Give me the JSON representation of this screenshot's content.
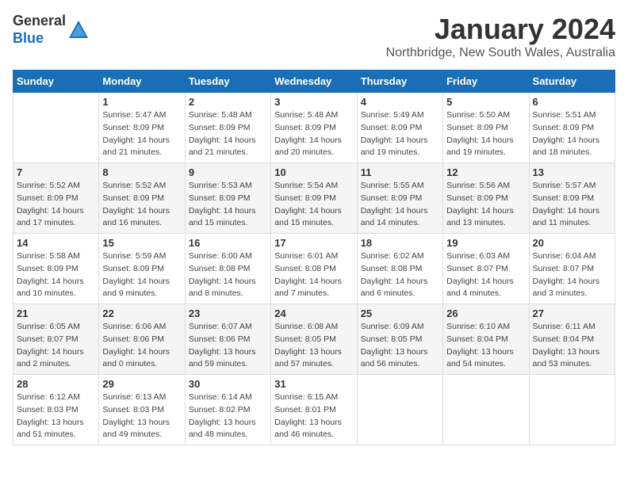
{
  "logo": {
    "general": "General",
    "blue": "Blue"
  },
  "header": {
    "title": "January 2024",
    "location": "Northbridge, New South Wales, Australia"
  },
  "columns": [
    "Sunday",
    "Monday",
    "Tuesday",
    "Wednesday",
    "Thursday",
    "Friday",
    "Saturday"
  ],
  "weeks": [
    [
      {
        "day": "",
        "info": ""
      },
      {
        "day": "1",
        "info": "Sunrise: 5:47 AM\nSunset: 8:09 PM\nDaylight: 14 hours\nand 21 minutes."
      },
      {
        "day": "2",
        "info": "Sunrise: 5:48 AM\nSunset: 8:09 PM\nDaylight: 14 hours\nand 21 minutes."
      },
      {
        "day": "3",
        "info": "Sunrise: 5:48 AM\nSunset: 8:09 PM\nDaylight: 14 hours\nand 20 minutes."
      },
      {
        "day": "4",
        "info": "Sunrise: 5:49 AM\nSunset: 8:09 PM\nDaylight: 14 hours\nand 19 minutes."
      },
      {
        "day": "5",
        "info": "Sunrise: 5:50 AM\nSunset: 8:09 PM\nDaylight: 14 hours\nand 19 minutes."
      },
      {
        "day": "6",
        "info": "Sunrise: 5:51 AM\nSunset: 8:09 PM\nDaylight: 14 hours\nand 18 minutes."
      }
    ],
    [
      {
        "day": "7",
        "info": "Sunrise: 5:52 AM\nSunset: 8:09 PM\nDaylight: 14 hours\nand 17 minutes."
      },
      {
        "day": "8",
        "info": "Sunrise: 5:52 AM\nSunset: 8:09 PM\nDaylight: 14 hours\nand 16 minutes."
      },
      {
        "day": "9",
        "info": "Sunrise: 5:53 AM\nSunset: 8:09 PM\nDaylight: 14 hours\nand 15 minutes."
      },
      {
        "day": "10",
        "info": "Sunrise: 5:54 AM\nSunset: 8:09 PM\nDaylight: 14 hours\nand 15 minutes."
      },
      {
        "day": "11",
        "info": "Sunrise: 5:55 AM\nSunset: 8:09 PM\nDaylight: 14 hours\nand 14 minutes."
      },
      {
        "day": "12",
        "info": "Sunrise: 5:56 AM\nSunset: 8:09 PM\nDaylight: 14 hours\nand 13 minutes."
      },
      {
        "day": "13",
        "info": "Sunrise: 5:57 AM\nSunset: 8:09 PM\nDaylight: 14 hours\nand 11 minutes."
      }
    ],
    [
      {
        "day": "14",
        "info": "Sunrise: 5:58 AM\nSunset: 8:09 PM\nDaylight: 14 hours\nand 10 minutes."
      },
      {
        "day": "15",
        "info": "Sunrise: 5:59 AM\nSunset: 8:09 PM\nDaylight: 14 hours\nand 9 minutes."
      },
      {
        "day": "16",
        "info": "Sunrise: 6:00 AM\nSunset: 8:08 PM\nDaylight: 14 hours\nand 8 minutes."
      },
      {
        "day": "17",
        "info": "Sunrise: 6:01 AM\nSunset: 8:08 PM\nDaylight: 14 hours\nand 7 minutes."
      },
      {
        "day": "18",
        "info": "Sunrise: 6:02 AM\nSunset: 8:08 PM\nDaylight: 14 hours\nand 6 minutes."
      },
      {
        "day": "19",
        "info": "Sunrise: 6:03 AM\nSunset: 8:07 PM\nDaylight: 14 hours\nand 4 minutes."
      },
      {
        "day": "20",
        "info": "Sunrise: 6:04 AM\nSunset: 8:07 PM\nDaylight: 14 hours\nand 3 minutes."
      }
    ],
    [
      {
        "day": "21",
        "info": "Sunrise: 6:05 AM\nSunset: 8:07 PM\nDaylight: 14 hours\nand 2 minutes."
      },
      {
        "day": "22",
        "info": "Sunrise: 6:06 AM\nSunset: 8:06 PM\nDaylight: 14 hours\nand 0 minutes."
      },
      {
        "day": "23",
        "info": "Sunrise: 6:07 AM\nSunset: 8:06 PM\nDaylight: 13 hours\nand 59 minutes."
      },
      {
        "day": "24",
        "info": "Sunrise: 6:08 AM\nSunset: 8:05 PM\nDaylight: 13 hours\nand 57 minutes."
      },
      {
        "day": "25",
        "info": "Sunrise: 6:09 AM\nSunset: 8:05 PM\nDaylight: 13 hours\nand 56 minutes."
      },
      {
        "day": "26",
        "info": "Sunrise: 6:10 AM\nSunset: 8:04 PM\nDaylight: 13 hours\nand 54 minutes."
      },
      {
        "day": "27",
        "info": "Sunrise: 6:11 AM\nSunset: 8:04 PM\nDaylight: 13 hours\nand 53 minutes."
      }
    ],
    [
      {
        "day": "28",
        "info": "Sunrise: 6:12 AM\nSunset: 8:03 PM\nDaylight: 13 hours\nand 51 minutes."
      },
      {
        "day": "29",
        "info": "Sunrise: 6:13 AM\nSunset: 8:03 PM\nDaylight: 13 hours\nand 49 minutes."
      },
      {
        "day": "30",
        "info": "Sunrise: 6:14 AM\nSunset: 8:02 PM\nDaylight: 13 hours\nand 48 minutes."
      },
      {
        "day": "31",
        "info": "Sunrise: 6:15 AM\nSunset: 8:01 PM\nDaylight: 13 hours\nand 46 minutes."
      },
      {
        "day": "",
        "info": ""
      },
      {
        "day": "",
        "info": ""
      },
      {
        "day": "",
        "info": ""
      }
    ]
  ]
}
